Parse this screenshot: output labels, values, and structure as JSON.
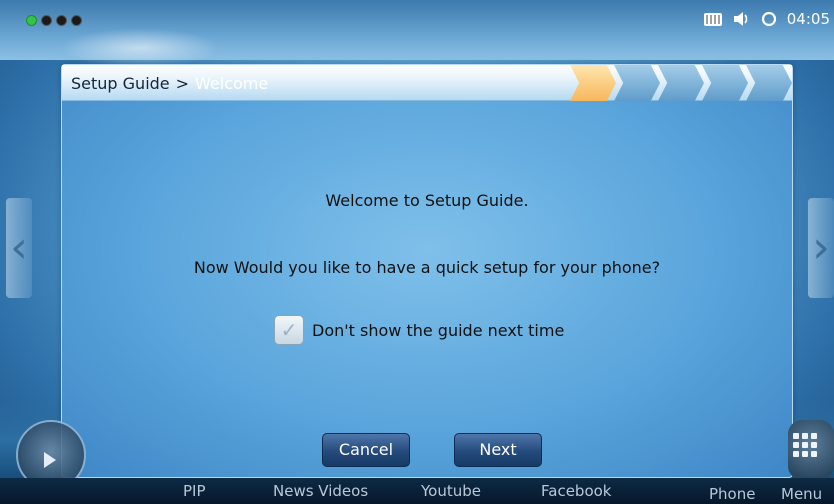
{
  "status_bar": {
    "time": "04:05",
    "icons": [
      "keyboard-icon",
      "volume-icon",
      "sync-icon"
    ]
  },
  "dialog": {
    "breadcrumb_root": "Setup Guide",
    "breadcrumb_sep": ">",
    "breadcrumb_current": "Welcome",
    "welcome_text": "Welcome to Setup Guide.",
    "question_text": "Now Would you like to have a quick setup for your phone?",
    "checkbox_label": "Don't show the guide next time",
    "cancel_label": "Cancel",
    "next_label": "Next",
    "steps_total": 5,
    "steps_active_index": 0
  },
  "dock": {
    "items": [
      "PIP",
      "News Videos",
      "Youtube",
      "Facebook",
      "Phone",
      "Menu"
    ]
  },
  "colors": {
    "accent": "#f7b75a",
    "button_bg": "#244b7c"
  }
}
